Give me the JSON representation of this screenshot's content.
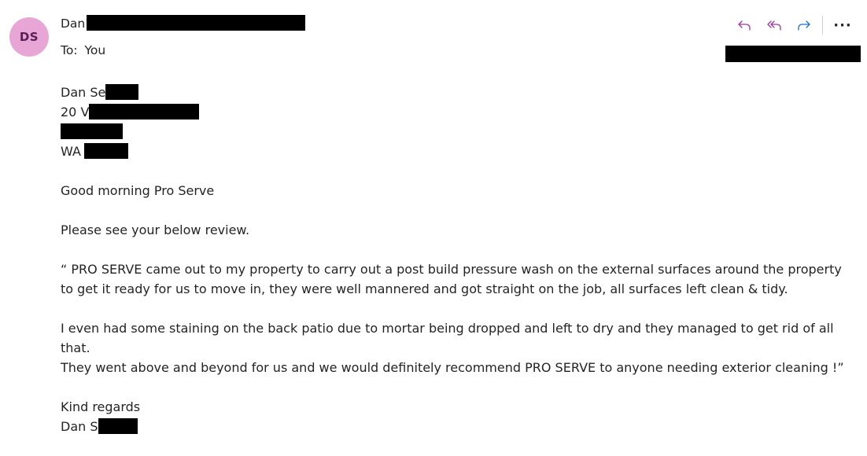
{
  "sender": {
    "initials": "DS",
    "avatar_bg": "#e8a6d6",
    "avatar_fg": "#5a1e52",
    "name_prefix": "Dan S",
    "to_label": "To:",
    "to_value": "You"
  },
  "toolbar": {
    "reply_icon": "reply-icon",
    "reply_all_icon": "reply-all-icon",
    "forward_icon": "forward-icon",
    "more_icon": "more-icon",
    "more_glyph": "···",
    "reply_color": "#9a3a9a",
    "forward_color": "#1e6fd0"
  },
  "body": {
    "address_name": "Dan Se",
    "address_line1": "20 V",
    "address_state": "WA",
    "greeting": "Good morning Pro Serve",
    "intro": "Please see your below review.",
    "review_line1": "“ PRO SERVE came out to my property to carry out a post build pressure wash on the external surfaces around the property",
    "review_line2": "to get it ready for us to move in, they were well mannered and got straight on the job, all surfaces left clean & tidy.",
    "review_line3": "I even had some staining on the back patio due to mortar being dropped and left to dry and they managed to get rid of all",
    "review_line4": "that.",
    "review_line5": "They went above and beyond for us and we would definitely recommend PRO SERVE to anyone needing exterior cleaning !”",
    "closing": "Kind regards",
    "signature": "Dan S"
  }
}
